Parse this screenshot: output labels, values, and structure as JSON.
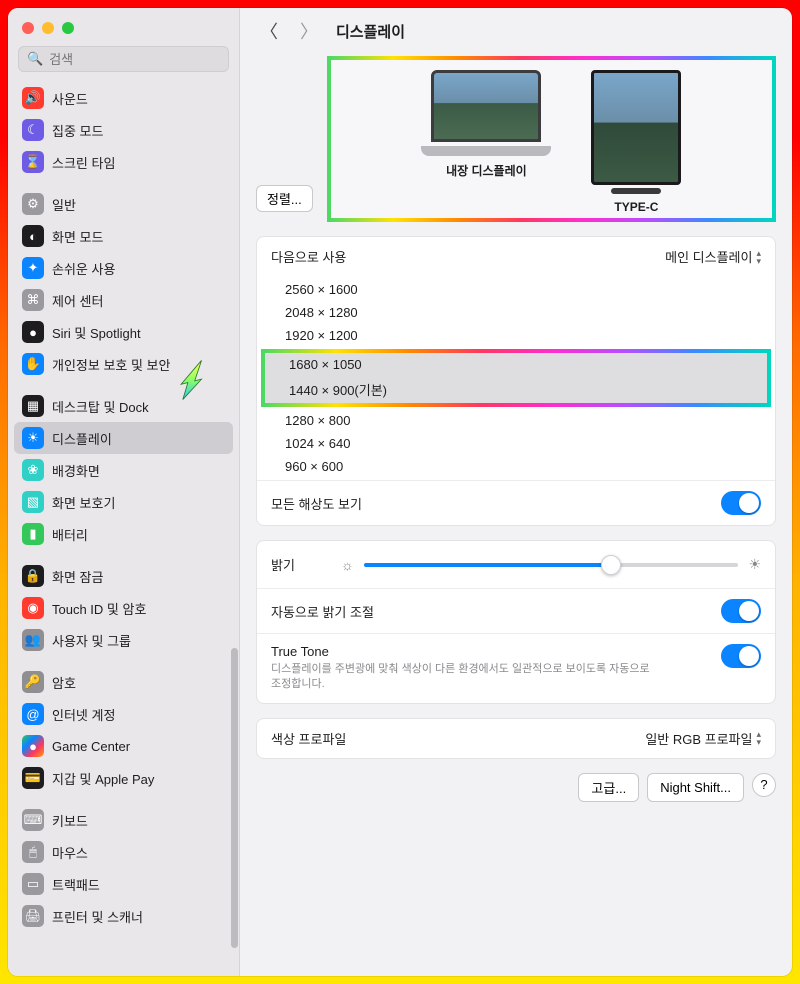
{
  "search": {
    "placeholder": "검색"
  },
  "sidebar": {
    "g0": [
      {
        "label": "사운드",
        "name": "sound",
        "bg": "#ff3b30",
        "glyph": "🔊"
      },
      {
        "label": "집중 모드",
        "name": "focus",
        "bg": "#6e5ce6",
        "glyph": "☾"
      },
      {
        "label": "스크린 타임",
        "name": "screen-time",
        "bg": "#6e5ce6",
        "glyph": "⌛"
      }
    ],
    "g1": [
      {
        "label": "일반",
        "name": "general",
        "bg": "#9a999d",
        "glyph": "⚙︎"
      },
      {
        "label": "화면 모드",
        "name": "appearance",
        "bg": "#1d1d1f",
        "glyph": "◐"
      },
      {
        "label": "손쉬운 사용",
        "name": "accessibility",
        "bg": "#0a84ff",
        "glyph": "✦"
      },
      {
        "label": "제어 센터",
        "name": "control-center",
        "bg": "#9a999d",
        "glyph": "⌘"
      },
      {
        "label": "Siri 및 Spotlight",
        "name": "siri",
        "bg": "#1d1d1f",
        "glyph": "●"
      },
      {
        "label": "개인정보 보호 및 보안",
        "name": "privacy",
        "bg": "#0a84ff",
        "glyph": "✋"
      }
    ],
    "g2": [
      {
        "label": "데스크탑 및 Dock",
        "name": "desktop-dock",
        "bg": "#1d1d1f",
        "glyph": "▦"
      },
      {
        "label": "디스플레이",
        "name": "displays",
        "bg": "#0a84ff",
        "glyph": "☀"
      },
      {
        "label": "배경화면",
        "name": "wallpaper",
        "bg": "#30d0c7",
        "glyph": "❀"
      },
      {
        "label": "화면 보호기",
        "name": "screensaver",
        "bg": "#30d0c7",
        "glyph": "▧"
      },
      {
        "label": "배터리",
        "name": "battery",
        "bg": "#34c759",
        "glyph": "▮"
      }
    ],
    "g3": [
      {
        "label": "화면 잠금",
        "name": "lock-screen",
        "bg": "#1d1d1f",
        "glyph": "🔒"
      },
      {
        "label": "Touch ID 및 암호",
        "name": "touch-id",
        "bg": "#ff3b30",
        "glyph": "◉"
      },
      {
        "label": "사용자 및 그룹",
        "name": "users-groups",
        "bg": "#8e8e93",
        "glyph": "👥"
      }
    ],
    "g4": [
      {
        "label": "암호",
        "name": "passwords",
        "bg": "#8e8e93",
        "glyph": "🔑"
      },
      {
        "label": "인터넷 계정",
        "name": "internet-acc",
        "bg": "#0a84ff",
        "glyph": "@"
      },
      {
        "label": "Game Center",
        "name": "game-center",
        "bg": "#ffffff",
        "glyph": "●"
      },
      {
        "label": "지갑 및 Apple Pay",
        "name": "wallet",
        "bg": "#1d1d1f",
        "glyph": "💳"
      }
    ],
    "g5": [
      {
        "label": "키보드",
        "name": "keyboard",
        "bg": "#9a999d",
        "glyph": "⌨"
      },
      {
        "label": "마우스",
        "name": "mouse",
        "bg": "#9a999d",
        "glyph": "🖱"
      },
      {
        "label": "트랙패드",
        "name": "trackpad",
        "bg": "#9a999d",
        "glyph": "▭"
      },
      {
        "label": "프린터 및 스캐너",
        "name": "printers",
        "bg": "#9a999d",
        "glyph": "🖨"
      }
    ]
  },
  "header": {
    "title": "디스플레이"
  },
  "arrange_label": "정렬...",
  "displays": {
    "builtin_label": "내장 디스플레이",
    "external_label": "TYPE-C"
  },
  "use_as": {
    "label": "다음으로 사용",
    "value": "메인 디스플레이"
  },
  "resolutions": {
    "before": [
      "2560 × 1600",
      "2048 × 1280",
      "1920 × 1200"
    ],
    "highlight": [
      "1680 × 1050",
      "1440 × 900(기본)"
    ],
    "after": [
      "1280 × 800",
      "1024 × 640",
      "960 × 600"
    ]
  },
  "show_all": {
    "label": "모든 해상도 보기"
  },
  "brightness": {
    "label": "밝기"
  },
  "auto_brightness": {
    "label": "자동으로 밝기 조절"
  },
  "true_tone": {
    "label": "True Tone",
    "desc": "디스플레이를 주변광에 맞춰 색상이 다른 환경에서도 일관적으로 보이도록 자동으로 조정합니다."
  },
  "color_profile": {
    "label": "색상 프로파일",
    "value": "일반 RGB 프로파일"
  },
  "footer": {
    "advanced": "고급...",
    "night_shift": "Night Shift...",
    "help": "?"
  }
}
